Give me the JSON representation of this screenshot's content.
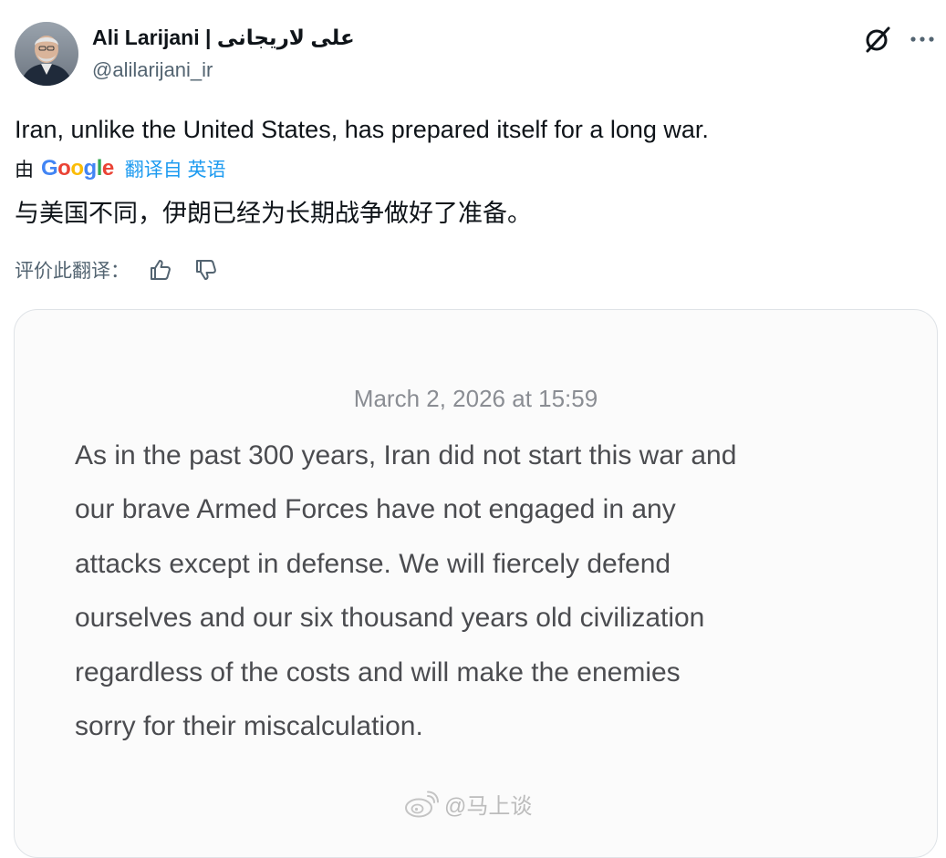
{
  "author": {
    "display_name": "Ali Larijani | علی لاریجانی",
    "handle": "@alilarijani_ir"
  },
  "icons": {
    "grok": "grok-icon",
    "more": "more-options-icon",
    "like": "thumbs-up-icon",
    "dislike": "thumbs-down-icon",
    "watermark": "weibo-icon"
  },
  "tweet": {
    "text": "Iran, unlike the United States, has prepared itself for a long war."
  },
  "translation": {
    "prefix": "由",
    "google_letters": [
      "G",
      "o",
      "o",
      "g",
      "l",
      "e"
    ],
    "source_link": "翻译自 英语",
    "text": "与美国不同，伊朗已经为长期战争做好了准备。",
    "rate_label": "评价此翻译："
  },
  "media": {
    "date": "March 2, 2026 at 15:59",
    "lines": [
      "As in the past 300 years, Iran did not start this war and",
      "our brave Armed Forces have not engaged in any",
      "attacks except in defense. We will fiercely defend",
      "ourselves and our six thousand years old civilization",
      "regardless of the costs and will make the enemies",
      "sorry for their miscalculation."
    ]
  },
  "watermark": {
    "text": "@马上谈"
  },
  "colors": {
    "link": "#1d9bf0",
    "secondary_text": "#536471",
    "primary_text": "#0f1419"
  }
}
